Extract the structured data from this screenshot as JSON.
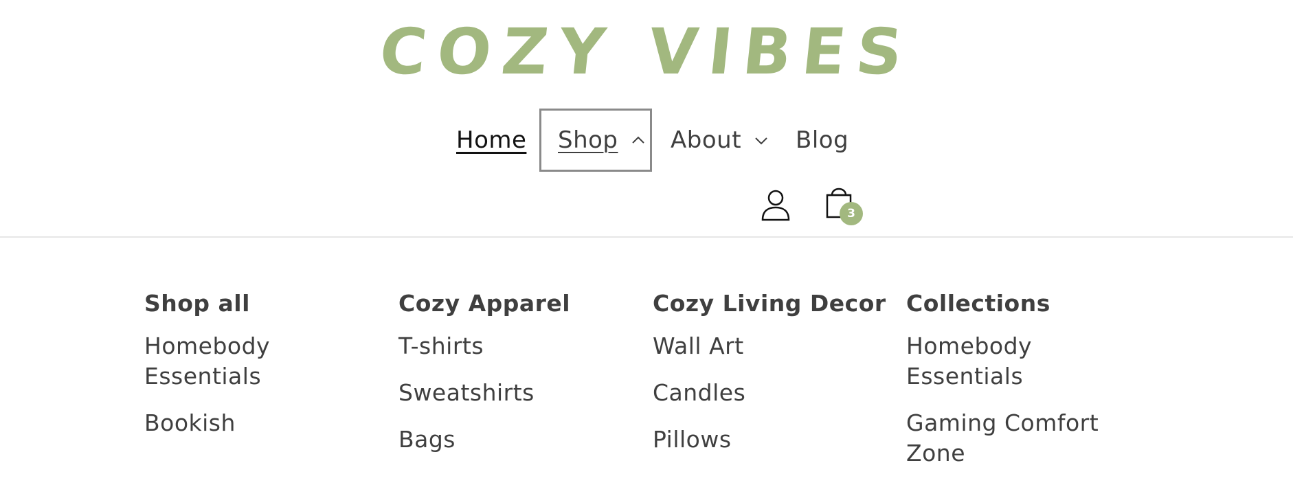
{
  "logo": {
    "text": "COZY VIBES",
    "color": "#a2b87f"
  },
  "nav": {
    "items": [
      {
        "label": "Home"
      },
      {
        "label": "Shop"
      },
      {
        "label": "About"
      },
      {
        "label": "Blog"
      }
    ],
    "icons": {
      "shop": "chevron-up-icon",
      "about": "chevron-down-icon"
    }
  },
  "header_icons": {
    "account": "account-icon",
    "cart": "shopping-bag-icon"
  },
  "cart": {
    "count": "3",
    "badge_color": "#a2b87f"
  },
  "menu": {
    "columns": [
      {
        "heading": "Shop all",
        "links": [
          "Homebody Essentials",
          "Bookish"
        ]
      },
      {
        "heading": "Cozy Apparel",
        "links": [
          "T-shirts",
          "Sweatshirts",
          "Bags"
        ]
      },
      {
        "heading": "Cozy Living Decor",
        "links": [
          "Wall Art",
          "Candles",
          "Pillows"
        ]
      },
      {
        "heading": "Collections",
        "links": [
          "Homebody Essentials",
          "Gaming Comfort Zone"
        ]
      }
    ]
  }
}
